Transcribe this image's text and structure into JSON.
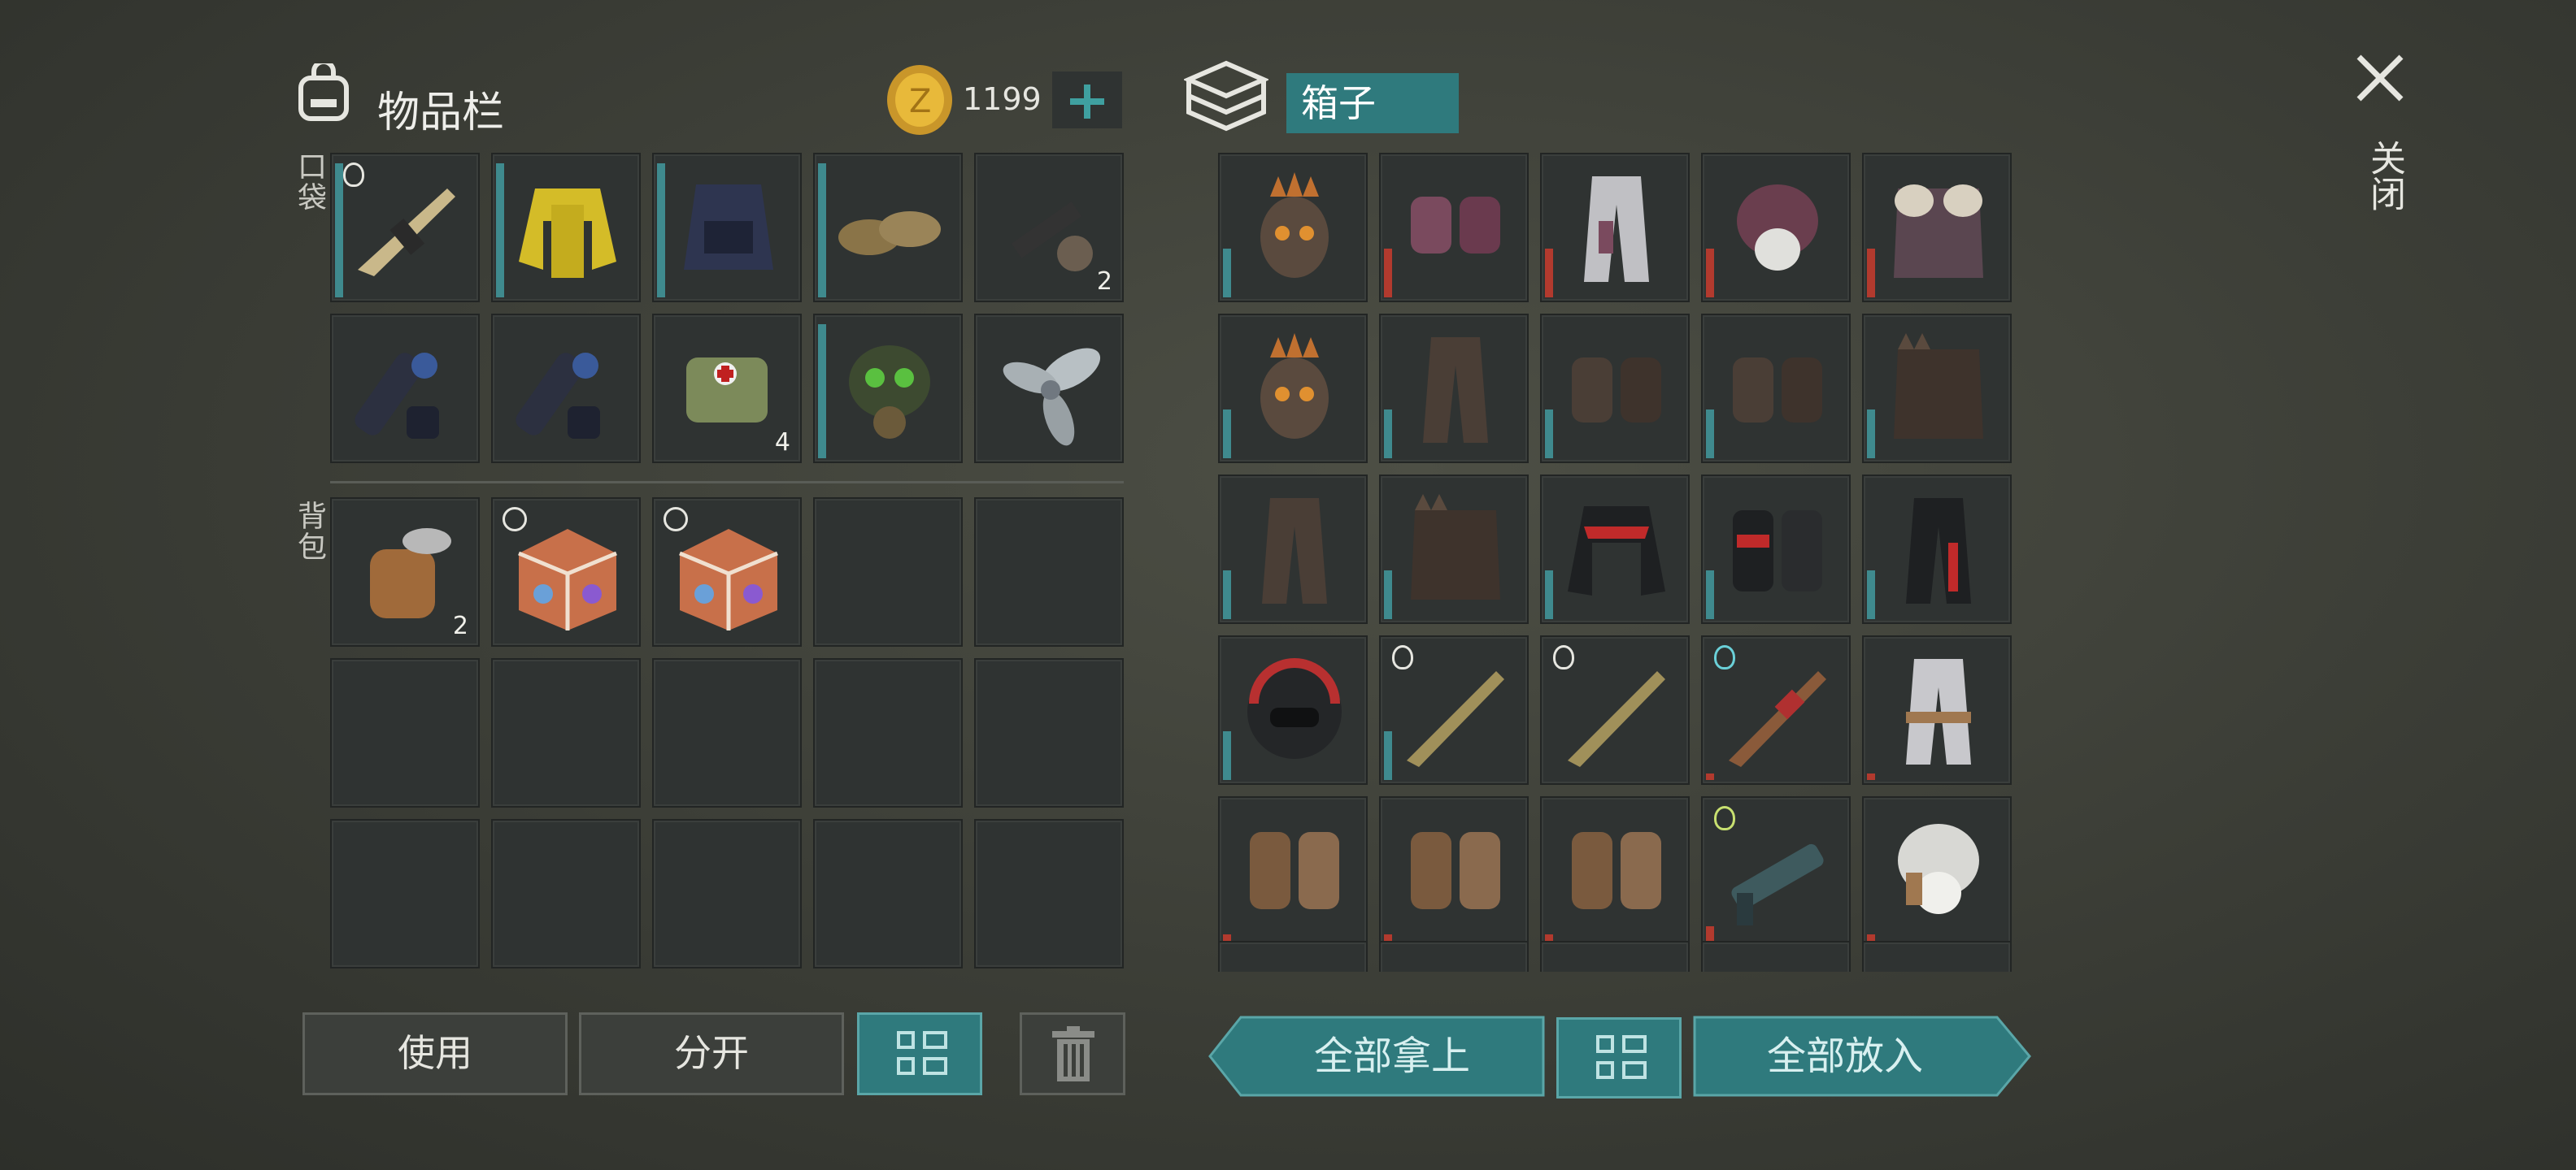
{
  "inventory": {
    "title": "物品栏",
    "coins": "1199",
    "pocket_label": "口袋",
    "backpack_label": "背包",
    "pocket_items": [
      {
        "name": "rifle",
        "qty": ""
      },
      {
        "name": "yellow-jacket",
        "qty": ""
      },
      {
        "name": "armored-vest",
        "qty": ""
      },
      {
        "name": "boots",
        "qty": ""
      },
      {
        "name": "parts-hammer",
        "qty": "2"
      },
      {
        "name": "flashlight-strap",
        "qty": ""
      },
      {
        "name": "flashlight-strap",
        "qty": ""
      },
      {
        "name": "medkit-bag",
        "qty": "4"
      },
      {
        "name": "gas-mask",
        "qty": ""
      },
      {
        "name": "propeller",
        "qty": ""
      }
    ],
    "backpack_items": [
      {
        "name": "tin-can",
        "qty": "2"
      },
      {
        "name": "supply-crate",
        "qty": ""
      },
      {
        "name": "supply-crate",
        "qty": ""
      }
    ]
  },
  "box": {
    "title": "箱子"
  },
  "close_label": "关闭",
  "buttons": {
    "use": "使用",
    "split": "分开",
    "take_all": "全部拿上",
    "put_all": "全部放入"
  },
  "colors": {
    "accent": "#2f7a7d",
    "durability_teal": "#3f8a8e",
    "durability_red": "#b23a2e"
  }
}
